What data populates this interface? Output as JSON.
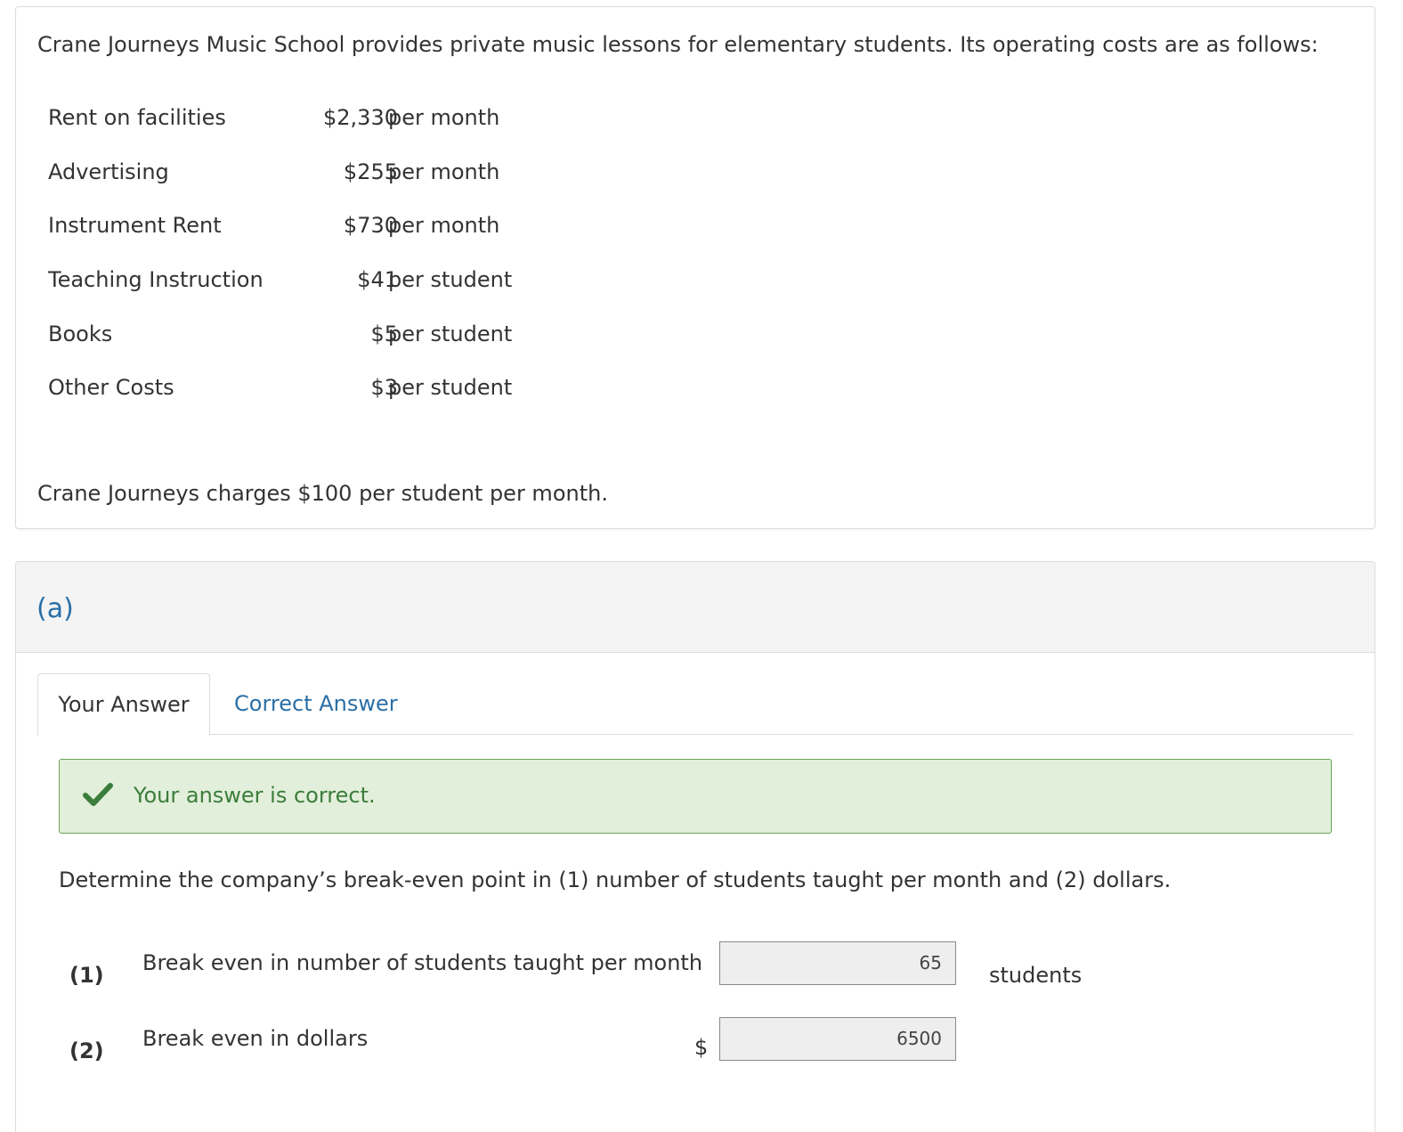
{
  "problem": {
    "intro": "Crane Journeys Music School provides private music lessons for elementary students. Its operating costs are as follows:",
    "costs": [
      {
        "label": "Rent on facilities",
        "amount": "$2,330",
        "unit": "per month"
      },
      {
        "label": "Advertising",
        "amount": "$255",
        "unit": "per month"
      },
      {
        "label": "Instrument Rent",
        "amount": "$730",
        "unit": "per month"
      },
      {
        "label": "Teaching Instruction",
        "amount": "$41",
        "unit": "per student"
      },
      {
        "label": "Books",
        "amount": "$5",
        "unit": "per student"
      },
      {
        "label": "Other Costs",
        "amount": "$3",
        "unit": "per student"
      }
    ],
    "charges": "Crane Journeys charges $100 per student per month."
  },
  "part": {
    "label": "(a)",
    "tabs": {
      "your_answer": "Your Answer",
      "correct_answer": "Correct Answer"
    },
    "alert": {
      "text": "Your answer is correct.",
      "color": "#3b7d3b",
      "icon": "check-icon"
    },
    "question": "Determine the company’s break-even point in (1) number of students taught per month and (2) dollars.",
    "rows": [
      {
        "num": "(1)",
        "label": "Break even in number of students taught per month",
        "prefix": "",
        "value": "65",
        "suffix": "students"
      },
      {
        "num": "(2)",
        "label": "Break even in dollars",
        "prefix": "$",
        "value": "6500",
        "suffix": ""
      }
    ]
  },
  "colors": {
    "link_blue": "#2a6fa6",
    "success_bg": "#e2efdb",
    "success_border": "#6aa55a",
    "header_bg": "#f4f4f4"
  }
}
